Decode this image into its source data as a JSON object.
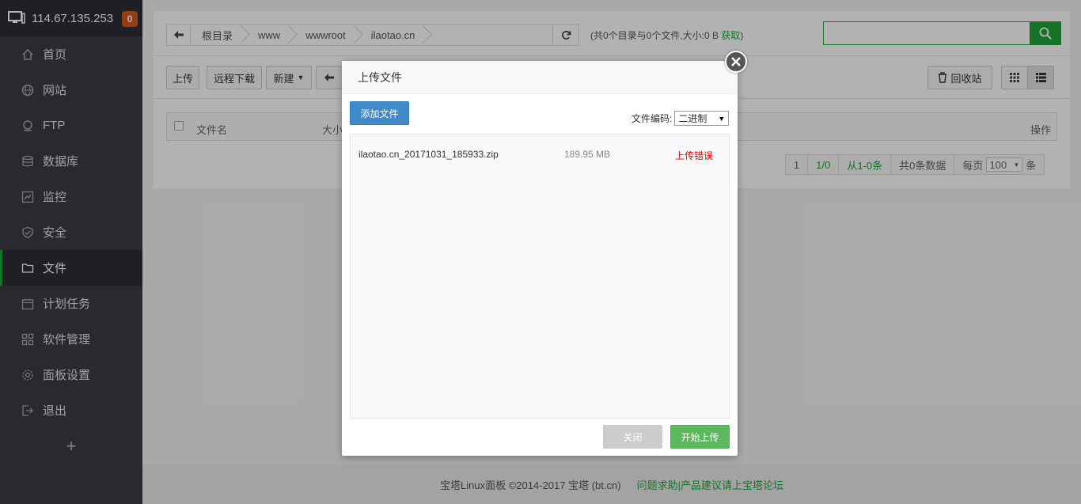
{
  "server": {
    "ip": "114.67.135.253",
    "badge": "0"
  },
  "sidebar": {
    "items": [
      {
        "label": "首页",
        "icon": "home-icon"
      },
      {
        "label": "网站",
        "icon": "globe-icon"
      },
      {
        "label": "FTP",
        "icon": "ftp-icon"
      },
      {
        "label": "数据库",
        "icon": "database-icon"
      },
      {
        "label": "监控",
        "icon": "monitor-icon"
      },
      {
        "label": "安全",
        "icon": "shield-icon"
      },
      {
        "label": "文件",
        "icon": "folder-icon"
      },
      {
        "label": "计划任务",
        "icon": "calendar-icon"
      },
      {
        "label": "软件管理",
        "icon": "grid-icon"
      },
      {
        "label": "面板设置",
        "icon": "gear-icon"
      },
      {
        "label": "退出",
        "icon": "exit-icon"
      }
    ],
    "active": "文件",
    "add": "+"
  },
  "path": {
    "crumbs": [
      "根目录",
      "www",
      "wwwroot",
      "ilaotao.cn"
    ]
  },
  "stat": {
    "text": "(共0个目录与0个文件,大小:0 B",
    "link": "获取",
    "close": ")"
  },
  "toolbar": {
    "upload": "上传",
    "remote": "远程下载",
    "new": "新建",
    "recycle": "回收站"
  },
  "table": {
    "col_name": "文件名",
    "col_size": "大小",
    "col_op": "操作"
  },
  "pager": {
    "p1": "1",
    "p2": "1/0",
    "range": "从1-0条",
    "total": "共0条数据",
    "per": "每页",
    "per_val": "100",
    "unit": "条"
  },
  "footer": {
    "copyright": "宝塔Linux面板 ©2014-2017 宝塔 (bt.cn)",
    "link": "问题求助|产品建议请上宝塔论坛"
  },
  "modal": {
    "title": "上传文件",
    "add_file": "添加文件",
    "enc_label": "文件编码:",
    "enc_value": "二进制",
    "file": {
      "name": "ilaotao.cn_20171031_185933.zip",
      "size": "189.95 MB",
      "status": "上传错误"
    },
    "close": "关闭",
    "start": "开始上传"
  },
  "colors": {
    "accent": "#20a53a",
    "sidebar": "#3a3d44",
    "error": "#e00000",
    "primary": "#428bca"
  }
}
